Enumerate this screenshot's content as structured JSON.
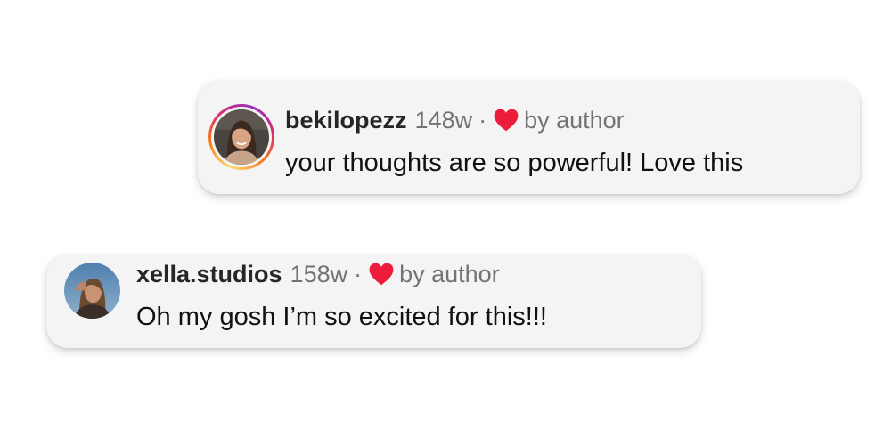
{
  "comments": [
    {
      "username": "bekilopezz",
      "time": "148w",
      "separator": "·",
      "liked_label": "by author",
      "text": "your thoughts are so powerful! Love this",
      "avatar_icon": "profile-photo-woman-smiling",
      "has_story_ring": true
    },
    {
      "username": "xella.studios",
      "time": "158w",
      "separator": "·",
      "liked_label": "by author",
      "text": "Oh my gosh I’m so excited for this!!!",
      "avatar_icon": "profile-photo-woman-outdoors",
      "has_story_ring": false
    }
  ],
  "colors": {
    "heart": "#ed1c3a",
    "card_background": "#f4f4f4",
    "username": "#262626",
    "meta": "#737373",
    "comment_text": "#111111"
  }
}
